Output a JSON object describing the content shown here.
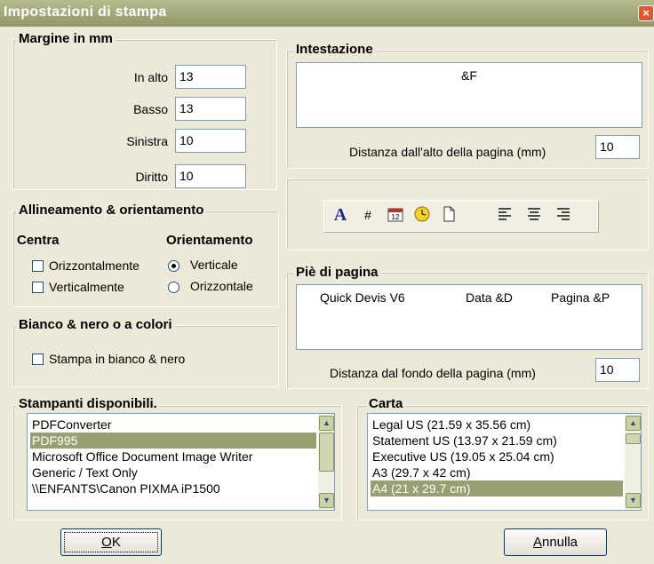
{
  "window": {
    "title": "Impostazioni di stampa",
    "close_glyph": "×",
    "close_icon": "close-icon"
  },
  "margins": {
    "group_label": "Margine in mm",
    "top": {
      "label": "In alto",
      "value": "13"
    },
    "bottom": {
      "label": "Basso",
      "value": "13"
    },
    "left": {
      "label": "Sinistra",
      "value": "10"
    },
    "right": {
      "label": "Diritto",
      "value": "10"
    }
  },
  "alignment": {
    "group_label": "Allineamento & orientamento",
    "center_label": "Centra",
    "orientation_label": "Orientamento",
    "horizontal": {
      "label": "Orizzontalmente",
      "checked": false
    },
    "vertical": {
      "label": "Verticalmente",
      "checked": false
    },
    "portrait": {
      "label": "Verticale",
      "selected": true
    },
    "landscape": {
      "label": "Orizzontale",
      "selected": false
    }
  },
  "color": {
    "group_label": "Bianco & nero o a colori",
    "bw": {
      "label": "Stampa in bianco & nero",
      "checked": false
    }
  },
  "header": {
    "group_label": "Intestazione",
    "text": "&F",
    "distance_label": "Distanza dall'alto della pagina (mm)",
    "distance_value": "10"
  },
  "toolbar": {
    "font_glyph": "A",
    "page_number_glyph": "#",
    "icons": [
      "font-icon",
      "page-number-icon",
      "date-icon",
      "time-icon",
      "file-icon",
      "align-left-icon",
      "align-center-icon",
      "align-right-icon"
    ]
  },
  "footer": {
    "group_label": "Piè di pagina",
    "left": "Quick Devis V6",
    "center": "Data &D",
    "right": "Pagina &P",
    "distance_label": "Distanza dal fondo della pagina (mm)",
    "distance_value": "10"
  },
  "printers": {
    "group_label": "Stampanti disponibili.",
    "items": [
      "PDFConverter",
      "PDF995",
      "Microsoft Office Document Image Writer",
      "Generic / Text Only",
      "\\\\ENFANTS\\Canon PIXMA iP1500"
    ],
    "selected": "PDF995"
  },
  "paper": {
    "group_label": "Carta",
    "items": [
      "Legal US (21.59 x 35.56 cm)",
      "Statement US (13.97 x 21.59 cm)",
      "Executive US (19.05 x 25.04 cm)",
      "A3 (29.7 x 42 cm)",
      "A4 (21 x 29.7 cm)"
    ],
    "selected": "A4 (21 x 29.7 cm)"
  },
  "buttons": {
    "ok": {
      "mnemonic": "O",
      "rest": "K"
    },
    "cancel": {
      "mnemonic": "A",
      "rest": "nnulla"
    }
  },
  "colors": {
    "titlebar": "#8f9668",
    "dialog_bg": "#ECE9D8",
    "selection": "#98a072",
    "close": "#e2572f"
  }
}
